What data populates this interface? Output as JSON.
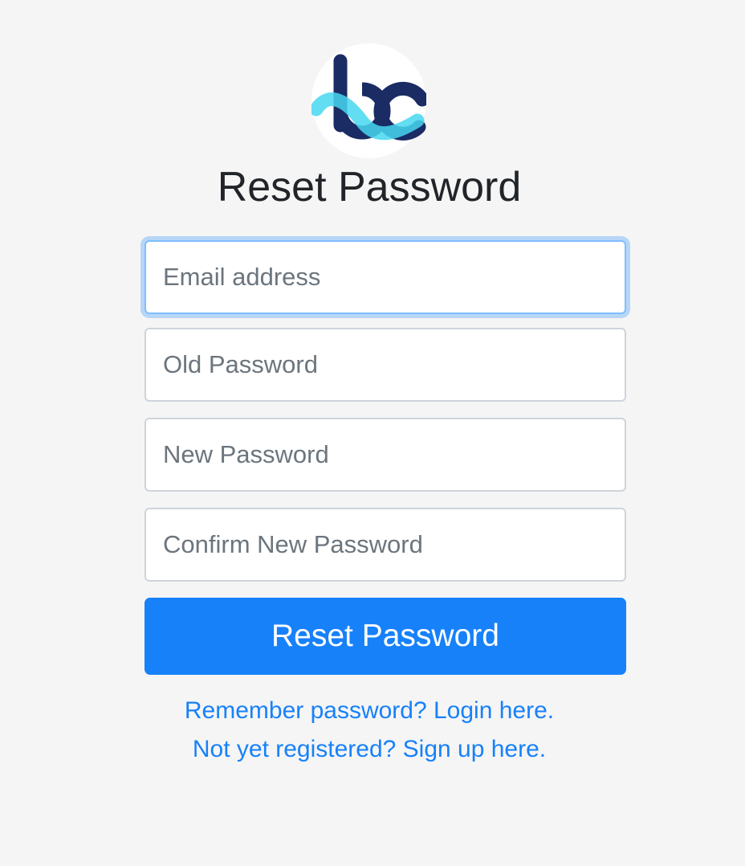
{
  "logo": {
    "icon": "bc-logo-icon",
    "colors": {
      "dark": "#1b2b64",
      "light": "#47d7f0"
    }
  },
  "title": "Reset Password",
  "form": {
    "email_placeholder": "Email address",
    "old_password_placeholder": "Old Password",
    "new_password_placeholder": "New Password",
    "confirm_password_placeholder": "Confirm New Password",
    "submit_label": "Reset Password"
  },
  "links": {
    "login": "Remember password? Login here.",
    "signup": "Not yet registered? Sign up here."
  },
  "colors": {
    "accent": "#1781fa",
    "background": "#f5f5f5"
  }
}
